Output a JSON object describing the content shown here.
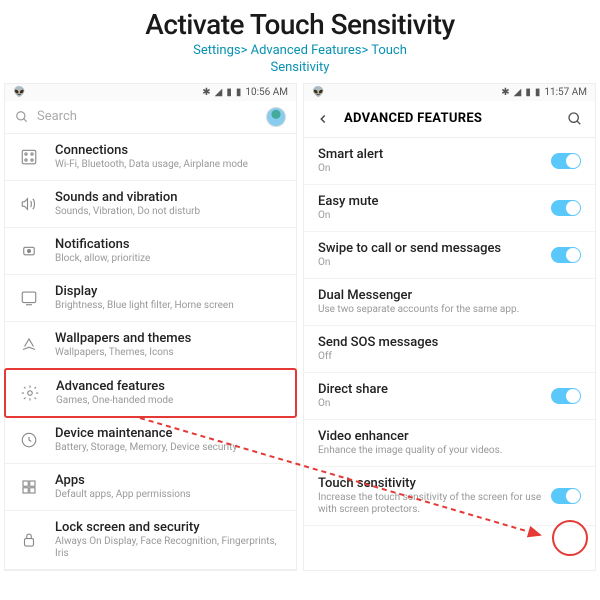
{
  "header": {
    "title": "Activate Touch Sensitivity",
    "breadcrumb": "Settings> Advanced Features> Touch\nSensitivity"
  },
  "left": {
    "status_time": "10:56 AM",
    "search_placeholder": "Search",
    "items": [
      {
        "label": "Connections",
        "sub": "Wi-Fi, Bluetooth, Data usage, Airplane mode"
      },
      {
        "label": "Sounds and vibration",
        "sub": "Sounds, Vibration, Do not disturb"
      },
      {
        "label": "Notifications",
        "sub": "Block, allow, prioritize"
      },
      {
        "label": "Display",
        "sub": "Brightness, Blue light filter, Home screen"
      },
      {
        "label": "Wallpapers and themes",
        "sub": "Wallpapers, Themes, Icons"
      },
      {
        "label": "Advanced features",
        "sub": "Games, One-handed mode"
      },
      {
        "label": "Device maintenance",
        "sub": "Battery, Storage, Memory, Device security"
      },
      {
        "label": "Apps",
        "sub": "Default apps, App permissions"
      },
      {
        "label": "Lock screen and security",
        "sub": "Always On Display, Face Recognition, Fingerprints, Iris"
      }
    ]
  },
  "right": {
    "status_time": "11:57 AM",
    "header_title": "ADVANCED FEATURES",
    "items": [
      {
        "label": "Smart alert",
        "sub": "On",
        "toggle": "on"
      },
      {
        "label": "Easy mute",
        "sub": "On",
        "toggle": "on"
      },
      {
        "label": "Swipe to call or send messages",
        "sub": "On",
        "toggle": "on"
      },
      {
        "label": "Dual Messenger",
        "sub": "Use two separate accounts for the same app."
      },
      {
        "label": "Send SOS messages",
        "sub": "Off"
      },
      {
        "label": "Direct share",
        "sub": "On",
        "toggle": "on"
      },
      {
        "label": "Video enhancer",
        "sub": "Enhance the image quality of your videos."
      },
      {
        "label": "Touch sensitivity",
        "sub": "Increase the touch sensitivity of the screen for use with screen protectors.",
        "toggle": "on"
      }
    ]
  }
}
